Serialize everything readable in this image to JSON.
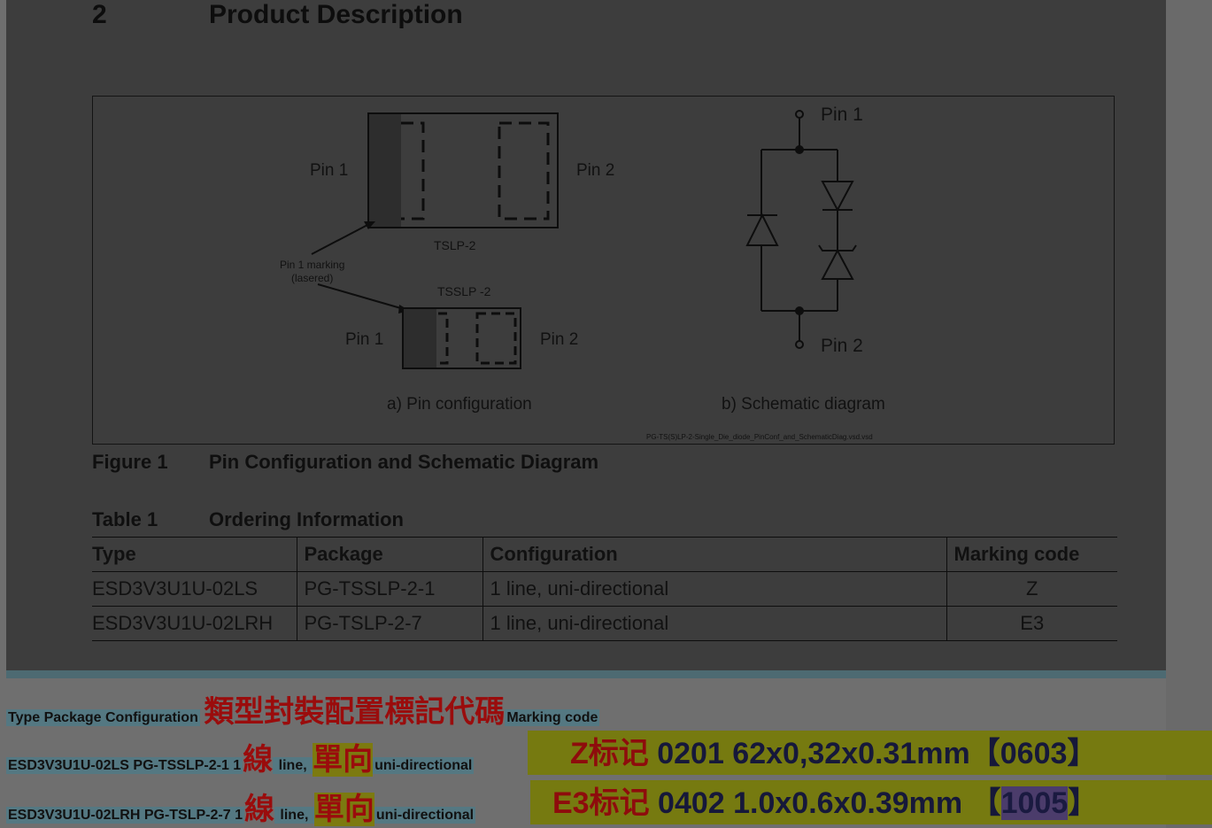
{
  "section": {
    "number": "2",
    "title": "Product Description"
  },
  "figure": {
    "pin1": "Pin 1",
    "pin2": "Pin 2",
    "tslp_label": "TSLP-2",
    "tsslp_label": "TSSLP -2",
    "marking_line1": "Pin 1 marking",
    "marking_line2": "(lasered)",
    "caption_a": "a) Pin configuration",
    "caption_b": "b) Schematic diagram",
    "filename": "PG-TS(S)LP-2-Single_Die_diode_PinConf_and_SchematicDiag.vsd.vsd",
    "label": "Figure 1",
    "title": "Pin Configuration and Schematic Diagram"
  },
  "table": {
    "label": "Table 1",
    "title": "Ordering Information",
    "headers": [
      "Type",
      "Package",
      "Configuration",
      "Marking code"
    ],
    "rows": [
      [
        "ESD3V3U1U-02LS",
        "PG-TSSLP-2-1",
        "1 line, uni-directional",
        "Z"
      ],
      [
        "ESD3V3U1U-02LRH",
        "PG-TSLP-2-7",
        "1 line, uni-directional",
        "E3"
      ]
    ]
  },
  "annotation": {
    "header_en": "Type Package Configuration",
    "header_cn": "類型封裝配置標記代碼",
    "header_en2": "Marking code",
    "row1": {
      "type_pkg": "ESD3V3U1U-02LS PG-TSSLP-2-1 1",
      "cn1": "線",
      "en1": " line, ",
      "cn2": "單向",
      "en2": "uni-directional",
      "band_code": "Z标记",
      "band_rest": " 0201   62x0,32x0.31mm【0603】"
    },
    "row2": {
      "type_pkg": "ESD3V3U1U-02LRH PG-TSLP-2-7 1",
      "cn1": "線",
      "en1": " line, ",
      "cn2": "單向",
      "en2": "uni-directional",
      "band_code": "E3标记",
      "band_mid": " 0402   1.0x0.6x0.39mm  【",
      "band_pkg": "1005",
      "band_end": "】"
    }
  }
}
